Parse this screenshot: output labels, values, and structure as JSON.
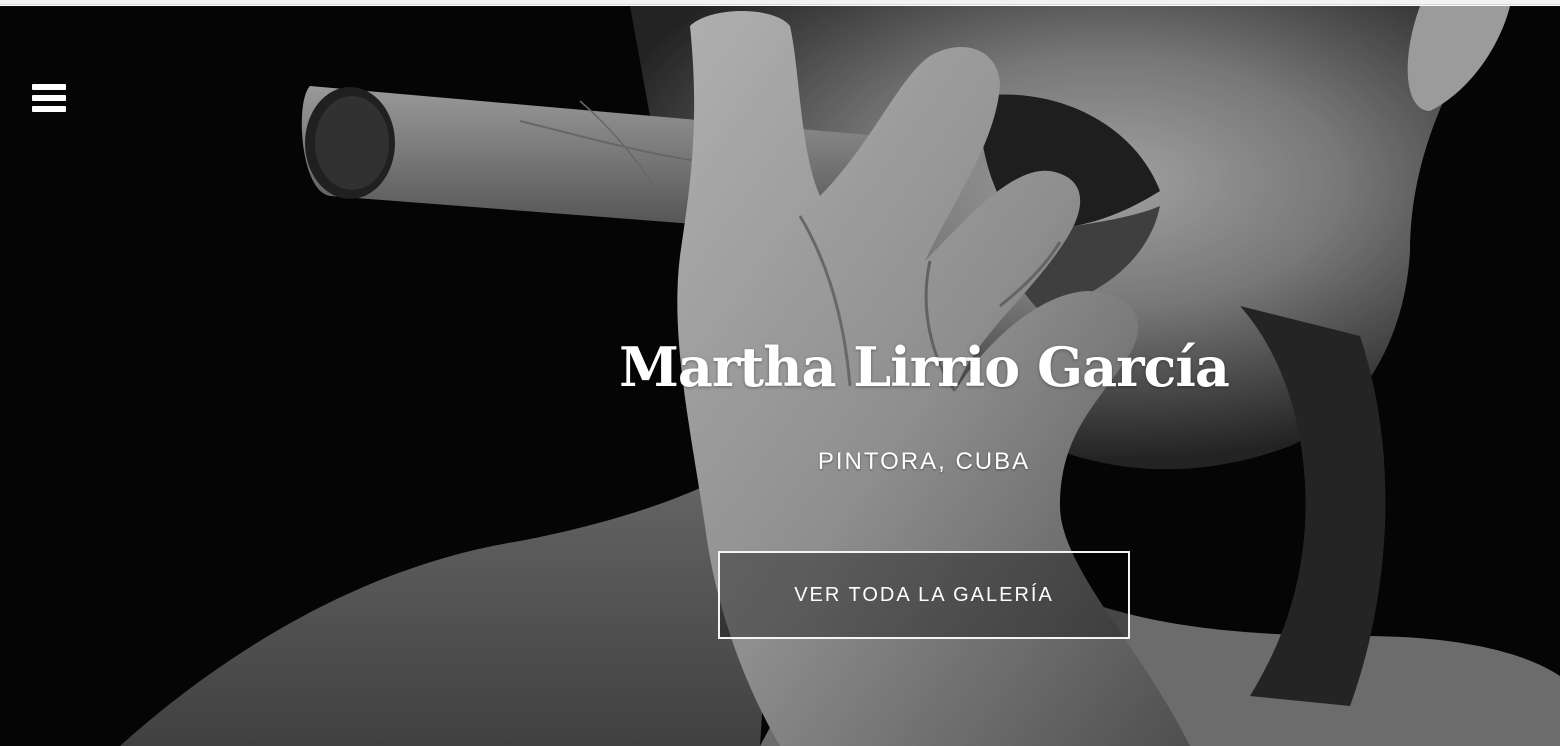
{
  "header": {
    "menu_icon": "hamburger-menu-icon"
  },
  "hero": {
    "background_image": "black-and-white portrait of a woman smoking a cigar",
    "title": "Martha Lirrio García",
    "subtitle": "PINTORA, CUBA",
    "cta_label": "VER TODA LA GALERÍA"
  },
  "colors": {
    "background": "#060606",
    "text": "#ffffff",
    "button_border": "#f4f4f4"
  }
}
